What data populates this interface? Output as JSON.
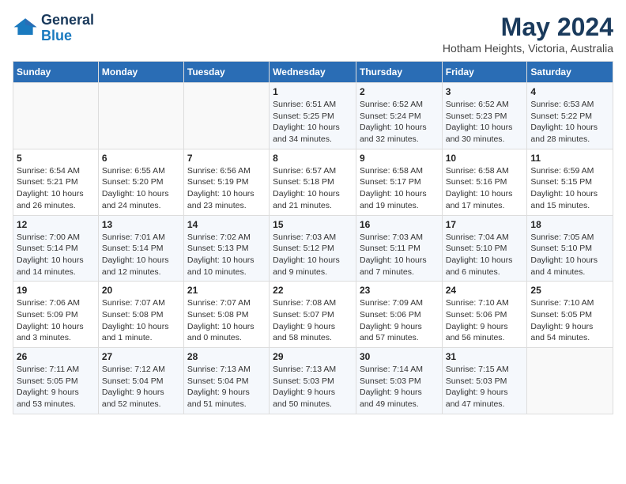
{
  "header": {
    "logo_line1": "General",
    "logo_line2": "Blue",
    "month_title": "May 2024",
    "location": "Hotham Heights, Victoria, Australia"
  },
  "days_of_week": [
    "Sunday",
    "Monday",
    "Tuesday",
    "Wednesday",
    "Thursday",
    "Friday",
    "Saturday"
  ],
  "weeks": [
    [
      {
        "day": "",
        "info": ""
      },
      {
        "day": "",
        "info": ""
      },
      {
        "day": "",
        "info": ""
      },
      {
        "day": "1",
        "info": "Sunrise: 6:51 AM\nSunset: 5:25 PM\nDaylight: 10 hours\nand 34 minutes."
      },
      {
        "day": "2",
        "info": "Sunrise: 6:52 AM\nSunset: 5:24 PM\nDaylight: 10 hours\nand 32 minutes."
      },
      {
        "day": "3",
        "info": "Sunrise: 6:52 AM\nSunset: 5:23 PM\nDaylight: 10 hours\nand 30 minutes."
      },
      {
        "day": "4",
        "info": "Sunrise: 6:53 AM\nSunset: 5:22 PM\nDaylight: 10 hours\nand 28 minutes."
      }
    ],
    [
      {
        "day": "5",
        "info": "Sunrise: 6:54 AM\nSunset: 5:21 PM\nDaylight: 10 hours\nand 26 minutes."
      },
      {
        "day": "6",
        "info": "Sunrise: 6:55 AM\nSunset: 5:20 PM\nDaylight: 10 hours\nand 24 minutes."
      },
      {
        "day": "7",
        "info": "Sunrise: 6:56 AM\nSunset: 5:19 PM\nDaylight: 10 hours\nand 23 minutes."
      },
      {
        "day": "8",
        "info": "Sunrise: 6:57 AM\nSunset: 5:18 PM\nDaylight: 10 hours\nand 21 minutes."
      },
      {
        "day": "9",
        "info": "Sunrise: 6:58 AM\nSunset: 5:17 PM\nDaylight: 10 hours\nand 19 minutes."
      },
      {
        "day": "10",
        "info": "Sunrise: 6:58 AM\nSunset: 5:16 PM\nDaylight: 10 hours\nand 17 minutes."
      },
      {
        "day": "11",
        "info": "Sunrise: 6:59 AM\nSunset: 5:15 PM\nDaylight: 10 hours\nand 15 minutes."
      }
    ],
    [
      {
        "day": "12",
        "info": "Sunrise: 7:00 AM\nSunset: 5:14 PM\nDaylight: 10 hours\nand 14 minutes."
      },
      {
        "day": "13",
        "info": "Sunrise: 7:01 AM\nSunset: 5:14 PM\nDaylight: 10 hours\nand 12 minutes."
      },
      {
        "day": "14",
        "info": "Sunrise: 7:02 AM\nSunset: 5:13 PM\nDaylight: 10 hours\nand 10 minutes."
      },
      {
        "day": "15",
        "info": "Sunrise: 7:03 AM\nSunset: 5:12 PM\nDaylight: 10 hours\nand 9 minutes."
      },
      {
        "day": "16",
        "info": "Sunrise: 7:03 AM\nSunset: 5:11 PM\nDaylight: 10 hours\nand 7 minutes."
      },
      {
        "day": "17",
        "info": "Sunrise: 7:04 AM\nSunset: 5:10 PM\nDaylight: 10 hours\nand 6 minutes."
      },
      {
        "day": "18",
        "info": "Sunrise: 7:05 AM\nSunset: 5:10 PM\nDaylight: 10 hours\nand 4 minutes."
      }
    ],
    [
      {
        "day": "19",
        "info": "Sunrise: 7:06 AM\nSunset: 5:09 PM\nDaylight: 10 hours\nand 3 minutes."
      },
      {
        "day": "20",
        "info": "Sunrise: 7:07 AM\nSunset: 5:08 PM\nDaylight: 10 hours\nand 1 minute."
      },
      {
        "day": "21",
        "info": "Sunrise: 7:07 AM\nSunset: 5:08 PM\nDaylight: 10 hours\nand 0 minutes."
      },
      {
        "day": "22",
        "info": "Sunrise: 7:08 AM\nSunset: 5:07 PM\nDaylight: 9 hours\nand 58 minutes."
      },
      {
        "day": "23",
        "info": "Sunrise: 7:09 AM\nSunset: 5:06 PM\nDaylight: 9 hours\nand 57 minutes."
      },
      {
        "day": "24",
        "info": "Sunrise: 7:10 AM\nSunset: 5:06 PM\nDaylight: 9 hours\nand 56 minutes."
      },
      {
        "day": "25",
        "info": "Sunrise: 7:10 AM\nSunset: 5:05 PM\nDaylight: 9 hours\nand 54 minutes."
      }
    ],
    [
      {
        "day": "26",
        "info": "Sunrise: 7:11 AM\nSunset: 5:05 PM\nDaylight: 9 hours\nand 53 minutes."
      },
      {
        "day": "27",
        "info": "Sunrise: 7:12 AM\nSunset: 5:04 PM\nDaylight: 9 hours\nand 52 minutes."
      },
      {
        "day": "28",
        "info": "Sunrise: 7:13 AM\nSunset: 5:04 PM\nDaylight: 9 hours\nand 51 minutes."
      },
      {
        "day": "29",
        "info": "Sunrise: 7:13 AM\nSunset: 5:03 PM\nDaylight: 9 hours\nand 50 minutes."
      },
      {
        "day": "30",
        "info": "Sunrise: 7:14 AM\nSunset: 5:03 PM\nDaylight: 9 hours\nand 49 minutes."
      },
      {
        "day": "31",
        "info": "Sunrise: 7:15 AM\nSunset: 5:03 PM\nDaylight: 9 hours\nand 47 minutes."
      },
      {
        "day": "",
        "info": ""
      }
    ]
  ]
}
